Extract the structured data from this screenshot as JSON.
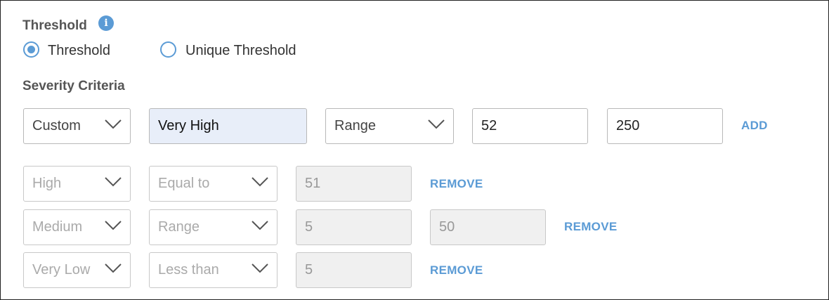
{
  "threshold": {
    "title": "Threshold",
    "info_icon": "info-icon",
    "options": [
      {
        "label": "Threshold",
        "selected": true
      },
      {
        "label": "Unique Threshold",
        "selected": false
      }
    ]
  },
  "severity": {
    "title": "Severity Criteria",
    "new_row": {
      "level": "Custom",
      "name_value": "Very High",
      "operator": "Range",
      "from_value": "52",
      "to_value": "250",
      "add_label": "ADD"
    },
    "rows": [
      {
        "level": "High",
        "operator": "Equal to",
        "value1": "51",
        "remove_label": "REMOVE"
      },
      {
        "level": "Medium",
        "operator": "Range",
        "value1": "5",
        "value2": "50",
        "remove_label": "REMOVE"
      },
      {
        "level": "Very Low",
        "operator": "Less than",
        "value1": "5",
        "remove_label": "REMOVE"
      }
    ]
  },
  "colors": {
    "accent": "#5b9bd5",
    "filled_input_bg": "#e8eef9",
    "readonly_bg": "#f0f0f0"
  }
}
